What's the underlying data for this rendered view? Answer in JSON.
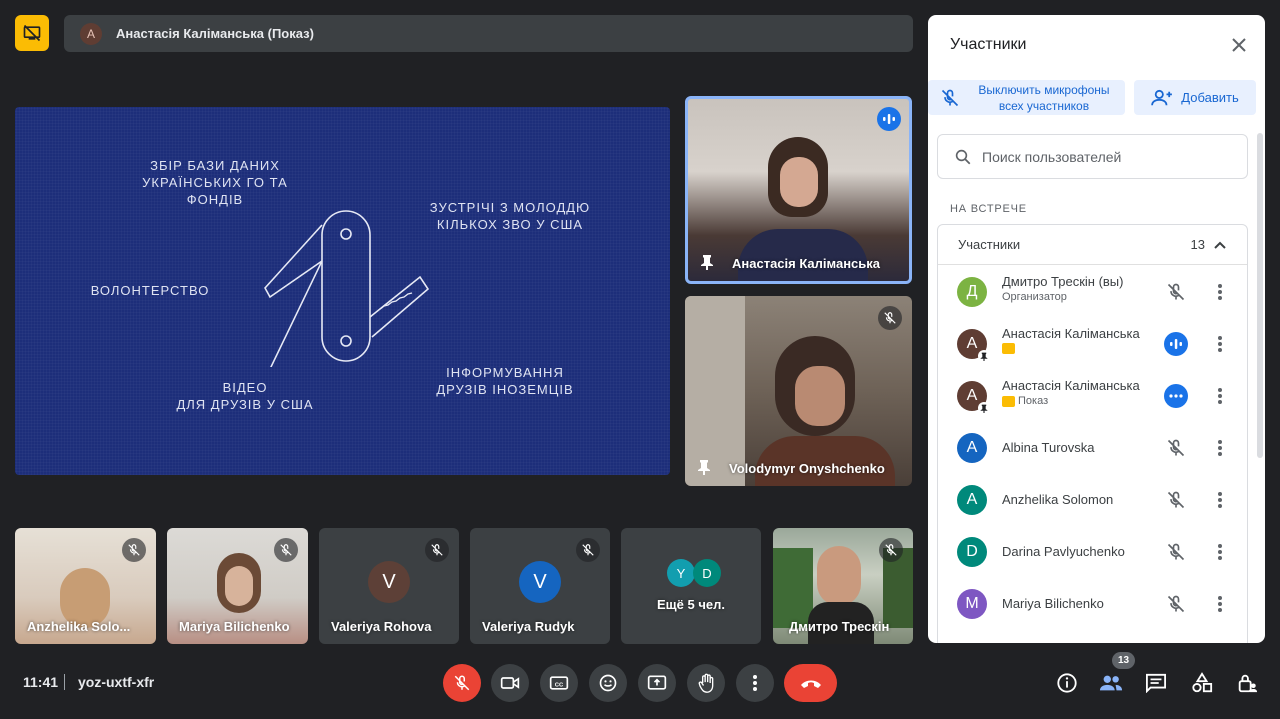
{
  "top": {
    "presenter_initial": "А",
    "presenter_title": "Анастасія Каліманська (Показ)"
  },
  "slide": {
    "labels": [
      "ЗБІР БАЗИ ДАНИХ\nУКРАЇНСЬКИХ ГО ТА ФОНДІВ",
      "ЗУСТРІЧІ З МОЛОДДЮ\nКІЛЬКОХ ЗВО У США",
      "ВОЛОНТЕРСТВО",
      "ІНФОРМУВАННЯ\nДРУЗІВ ІНОЗЕМЦІВ",
      "ВІДЕО\nДЛЯ ДРУЗІВ У США"
    ]
  },
  "tiles": {
    "speaker": "Анастасія Каліманська",
    "second": "Volodymyr Onyshchenko",
    "strip": [
      {
        "name": "Anzhelika Solo...",
        "initial": "",
        "color": ""
      },
      {
        "name": "Mariya Bilichenko",
        "initial": "",
        "color": ""
      },
      {
        "name": "Valeriya Rohova",
        "initial": "V",
        "color": "#5d4037"
      },
      {
        "name": "Valeriya Rudyk",
        "initial": "V",
        "color": "#1565c0"
      },
      {
        "name": "Дмитро Трескін",
        "initial": "",
        "color": ""
      }
    ],
    "more": {
      "label": "Ещё 5 чел.",
      "initials": [
        "Y",
        "D"
      ],
      "colors": [
        "#129eaf",
        "#00897b"
      ]
    }
  },
  "panel": {
    "title": "Участники",
    "mute_all": "Выключить микрофоны всех участников",
    "add": "Добавить",
    "search_placeholder": "Поиск пользователей",
    "section": "НА ВСТРЕЧЕ",
    "group_label": "Участники",
    "group_count": "13",
    "participants": [
      {
        "initial": "Д",
        "color": "#7cb342",
        "name": "Дмитро Трескін (вы)",
        "sub": "Организатор",
        "state": "muted"
      },
      {
        "initial": "А",
        "color": "#5f3d33",
        "name": "Анастасія Каліманська",
        "sub": "",
        "state": "speaking",
        "pinned": true
      },
      {
        "initial": "А",
        "color": "#5f3d33",
        "name": "Анастасія Каліманська",
        "sub": "Показ",
        "state": "presenting",
        "pinned": true
      },
      {
        "initial": "A",
        "color": "#1565c0",
        "name": "Albina Turovska",
        "sub": "",
        "state": "muted"
      },
      {
        "initial": "A",
        "color": "#00897b",
        "name": "Anzhelika Solomon",
        "sub": "",
        "state": "muted"
      },
      {
        "initial": "D",
        "color": "#00897b",
        "name": "Darina Pavlyuchenko",
        "sub": "",
        "state": "muted"
      },
      {
        "initial": "M",
        "color": "#7e57c2",
        "name": "Mariya Bilichenko",
        "sub": "",
        "state": "muted"
      }
    ]
  },
  "bottom": {
    "time": "11:41",
    "code": "yoz-uxtf-xfr",
    "people_count": "13"
  },
  "colors": {
    "accent": "#1a73e8",
    "danger": "#ea4335",
    "present": "#fbbc04"
  }
}
